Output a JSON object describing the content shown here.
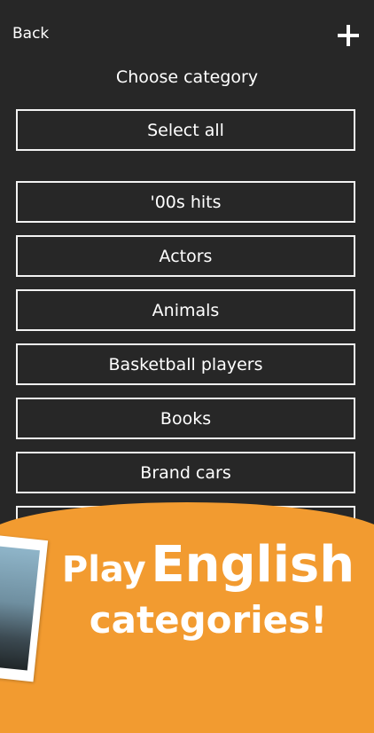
{
  "header": {
    "back_label": "Back",
    "title": "Choose category"
  },
  "select_all_label": "Select all",
  "categories": [
    "'00s hits",
    "Actors",
    "Animals",
    "Basketball players",
    "Books",
    "Brand cars"
  ],
  "promo": {
    "word1": "Play",
    "word2": "English",
    "word3": "categories!"
  },
  "colors": {
    "background": "#272727",
    "accent": "#f29b30",
    "text": "#ffffff"
  }
}
